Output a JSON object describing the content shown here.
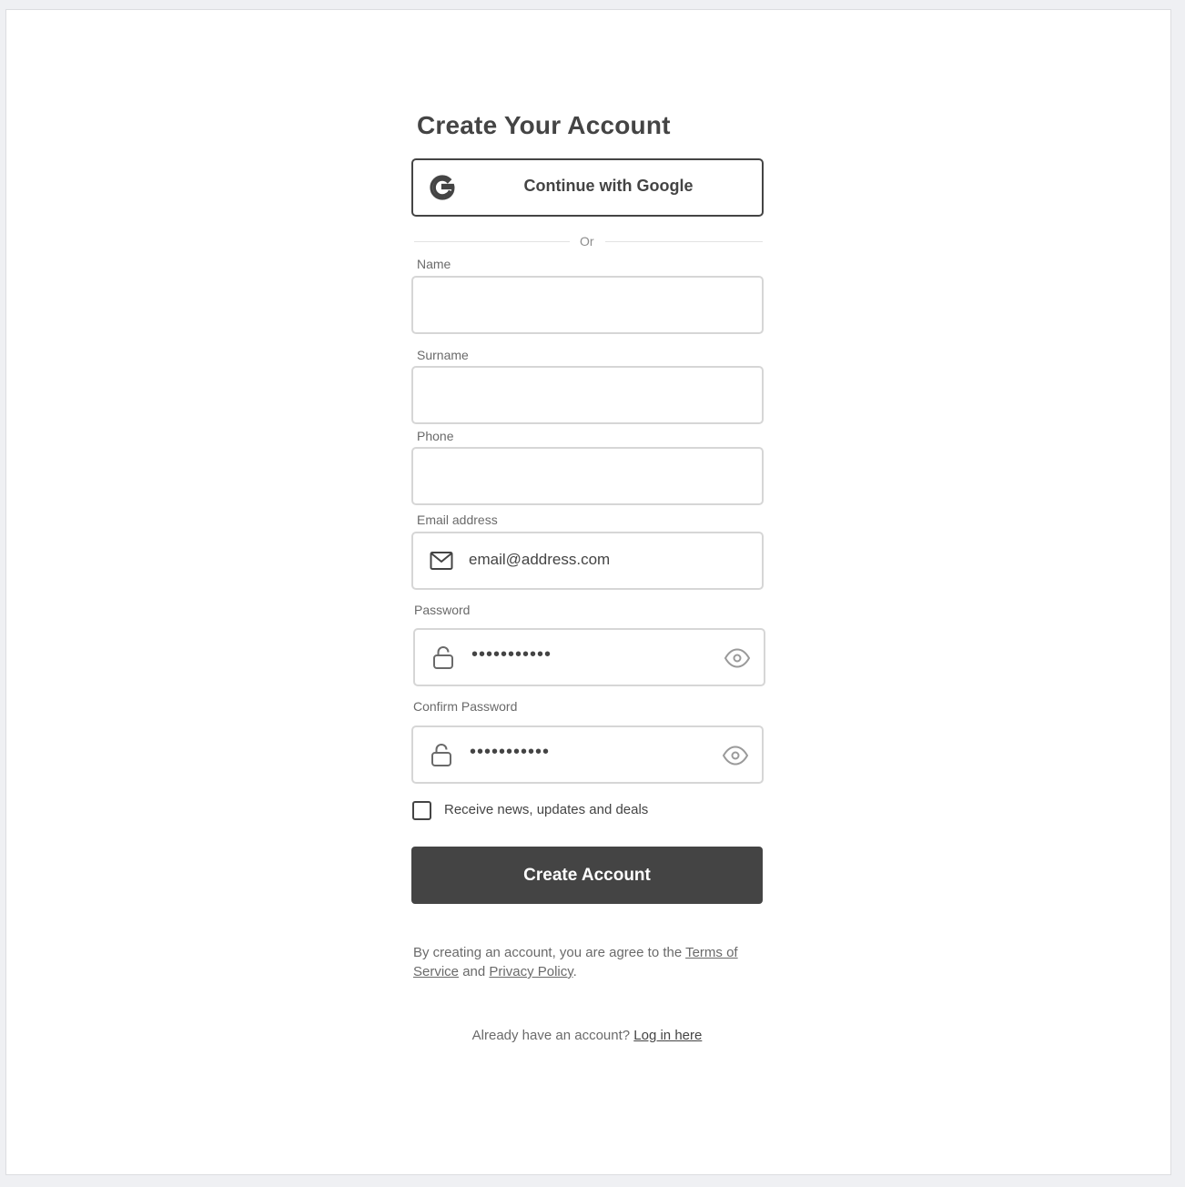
{
  "form": {
    "title": "Create Your Account",
    "google_button_label": "Continue with Google",
    "divider_text": "Or",
    "fields": {
      "name": {
        "label": "Name",
        "value": ""
      },
      "surname": {
        "label": "Surname",
        "value": ""
      },
      "phone": {
        "label": "Phone",
        "value": ""
      },
      "email": {
        "label": "Email address",
        "value": "email@address.com",
        "icon": "mail-icon"
      },
      "password": {
        "label": "Password",
        "value": "•••••••••••",
        "icon": "lock-icon",
        "toggle_icon": "eye-icon"
      },
      "confirm_password": {
        "label": "Confirm Password",
        "value": "•••••••••••",
        "icon": "lock-icon",
        "toggle_icon": "eye-icon"
      }
    },
    "newsletter_checkbox": {
      "label": "Receive news, updates and deals",
      "checked": false
    },
    "submit_label": "Create Account",
    "terms": {
      "prefix": "By creating an account, you are agree to the ",
      "terms_link": "Terms of Service",
      "middle": " and ",
      "privacy_link": "Privacy Policy",
      "suffix": "."
    },
    "login": {
      "prompt": "Already have an account? ",
      "link": "Log in here"
    }
  },
  "colors": {
    "primary": "#444444",
    "border": "#d6d6d6",
    "muted_text": "#6a6a6a",
    "background": "#eff0f3"
  }
}
